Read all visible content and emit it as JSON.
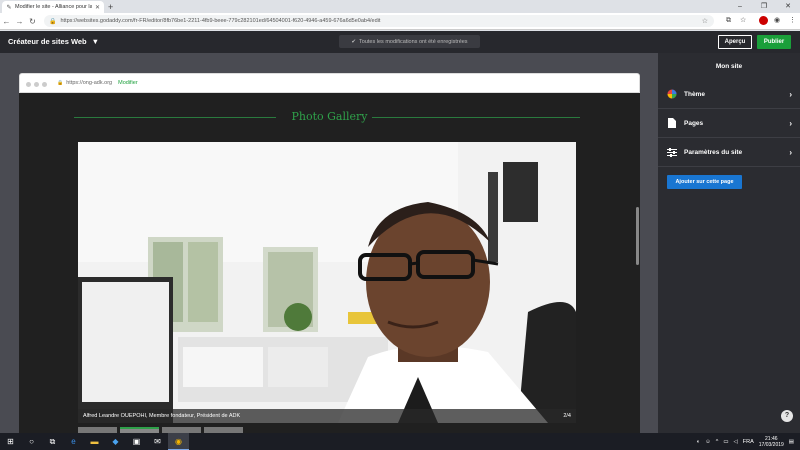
{
  "browser": {
    "tab_title": "Modifier le site - Alliance pour la",
    "url": "https://websites.godaddy.com/fr-FR/editor/8fb76be1-2211-4fb9-beee-779c282101ed/64504001-f620-4946-a459-676a6d5e0ab4/edit"
  },
  "header": {
    "title": "Créateur de sites Web",
    "status": "Toutes les modifications ont été enregistrées",
    "preview_label": "Aperçu",
    "publish_label": "Publier"
  },
  "preview": {
    "url": "https://ong-adk.org",
    "edit_label": "Modifier",
    "gallery_title": "Photo Gallery",
    "caption": "Alfred Leandre OUEPOHI, Membre fondateur, Président de ADK",
    "counter": "2/4"
  },
  "panel": {
    "title": "Mon site",
    "items": [
      {
        "label": "Thème",
        "icon": "palette-icon"
      },
      {
        "label": "Pages",
        "icon": "page-icon"
      },
      {
        "label": "Paramètres du site",
        "icon": "sliders-icon"
      }
    ],
    "add_label": "Ajouter sur cette page"
  },
  "taskbar": {
    "lang": "FRA",
    "time": "21:46",
    "date": "17/03/2019"
  },
  "colors": {
    "accent_green": "#1a9f3a",
    "gallery_green": "#2fa14a",
    "primary_blue": "#1976d2"
  }
}
